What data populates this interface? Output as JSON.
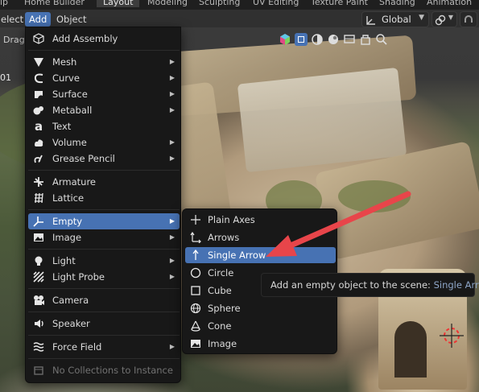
{
  "workspace_tabs": [
    "ip",
    "Home Builder",
    "Layout",
    "Modeling",
    "Sculpting",
    "UV Editing",
    "Texture Paint",
    "Shading",
    "Animation"
  ],
  "active_workspace": "Layout",
  "header": {
    "select_label": "elect",
    "add_label": "Add",
    "object_label": "Object",
    "orientation_value": "Global"
  },
  "viewport": {
    "drag_label": "Drag",
    "frame_label": "01"
  },
  "add_menu": {
    "items": [
      {
        "label": "Add Assembly",
        "icon": "cube-outline-icon"
      },
      {
        "label": "Mesh",
        "icon": "mesh-icon"
      },
      {
        "label": "Curve",
        "icon": "curve-icon"
      },
      {
        "label": "Surface",
        "icon": "surface-icon"
      },
      {
        "label": "Metaball",
        "icon": "metaball-icon"
      },
      {
        "label": "Text",
        "icon": "text-icon"
      },
      {
        "label": "Volume",
        "icon": "volume-icon"
      },
      {
        "label": "Grease Pencil",
        "icon": "grease-pencil-icon"
      },
      {
        "label": "Armature",
        "icon": "armature-icon"
      },
      {
        "label": "Lattice",
        "icon": "lattice-icon"
      },
      {
        "label": "Empty",
        "icon": "empty-icon"
      },
      {
        "label": "Image",
        "icon": "image-icon"
      },
      {
        "label": "Light",
        "icon": "light-icon"
      },
      {
        "label": "Light Probe",
        "icon": "light-probe-icon"
      },
      {
        "label": "Camera",
        "icon": "camera-icon"
      },
      {
        "label": "Speaker",
        "icon": "speaker-icon"
      },
      {
        "label": "Force Field",
        "icon": "force-field-icon"
      },
      {
        "label": "No Collections to Instance",
        "icon": "collection-icon"
      }
    ]
  },
  "empty_submenu": {
    "items": [
      {
        "label": "Plain Axes",
        "icon": "plain-axes-icon"
      },
      {
        "label": "Arrows",
        "icon": "arrows-icon"
      },
      {
        "label": "Single Arrow",
        "icon": "single-arrow-icon"
      },
      {
        "label": "Circle",
        "icon": "circle-icon"
      },
      {
        "label": "Cube",
        "icon": "cube-icon"
      },
      {
        "label": "Sphere",
        "icon": "sphere-icon"
      },
      {
        "label": "Cone",
        "icon": "cone-icon"
      },
      {
        "label": "Image",
        "icon": "image-icon"
      }
    ]
  },
  "tooltip": {
    "text": "Add an empty object to the scene:",
    "python": "Single Arrow"
  },
  "colors": {
    "highlight": "#4772b3",
    "annotation_arrow": "#e8454a"
  }
}
